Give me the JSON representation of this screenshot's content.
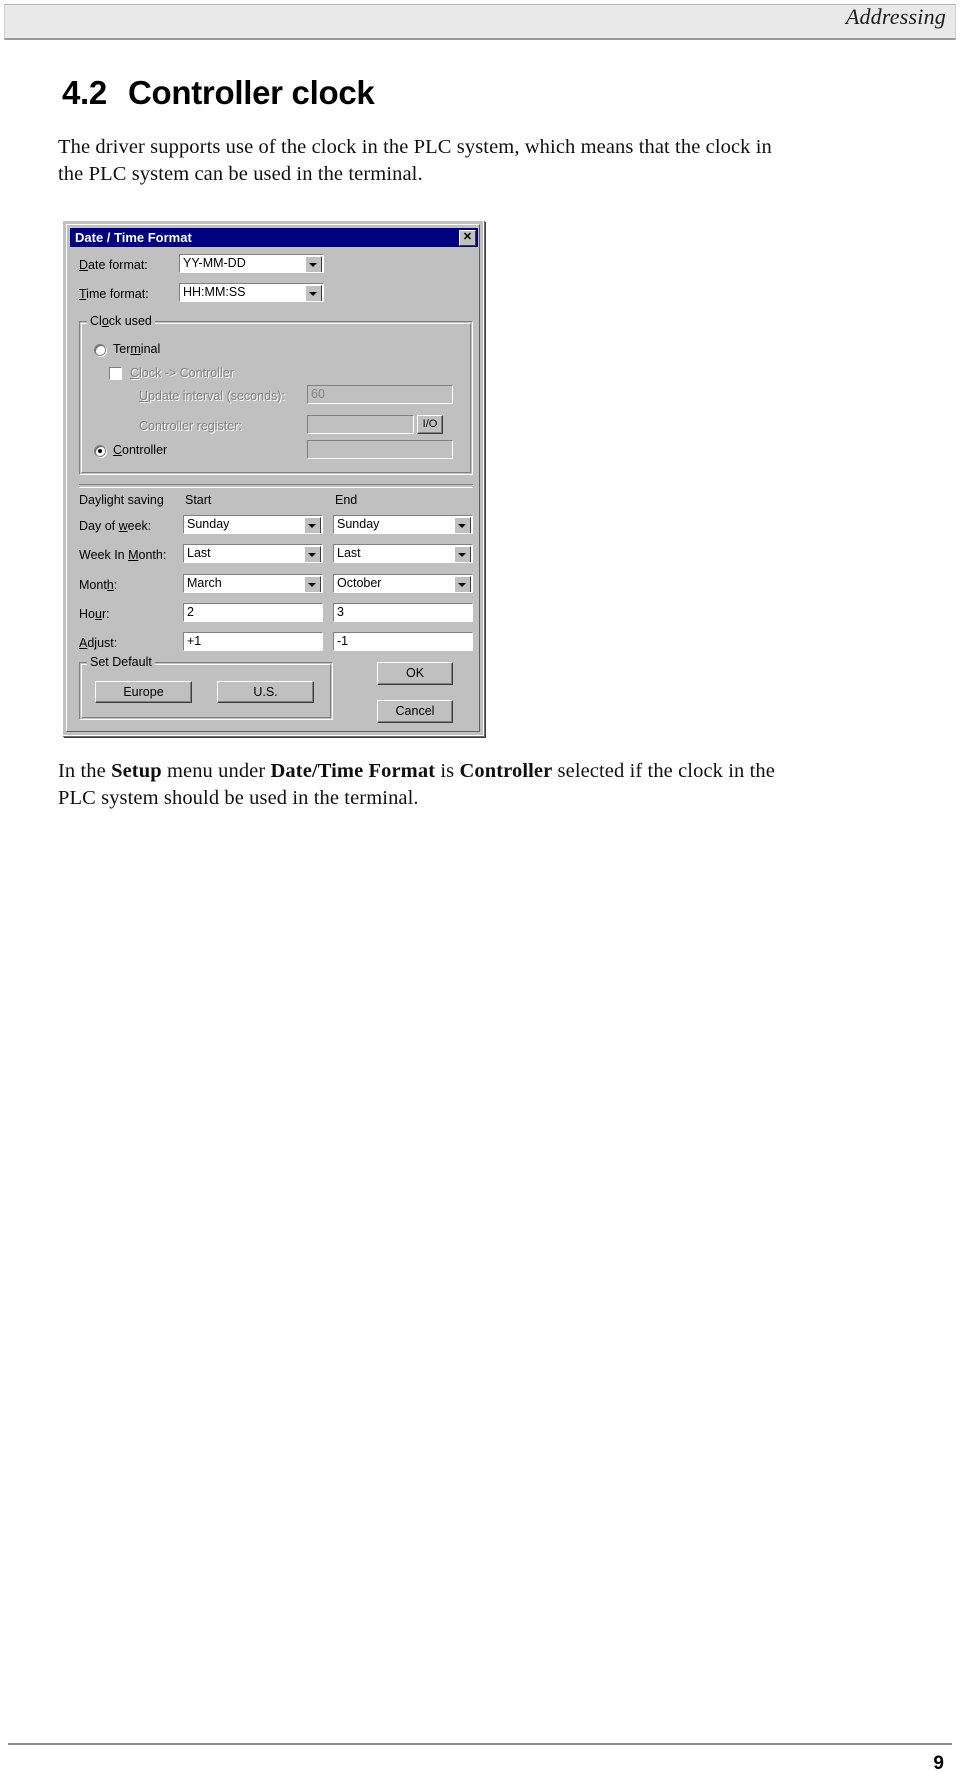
{
  "header": {
    "running_title": "Addressing"
  },
  "section": {
    "number": "4.2",
    "title": "Controller clock"
  },
  "intro_paragraph": "The driver supports use of the clock in the PLC system, which means that the clock in the PLC system can be used in the terminal.",
  "outro_paragraph_parts": {
    "p1": "In the ",
    "b1": "Setup",
    "p2": " menu under ",
    "b2": "Date/Time Format",
    "p3": " is ",
    "b3": "Controller",
    "p4": " selected if the clock in the PLC system should be used in the terminal."
  },
  "dialog": {
    "title": "Date / Time Format",
    "close_glyph": "✕",
    "date_format": {
      "label": "Date format:",
      "accel": "D",
      "value": "YY-MM-DD"
    },
    "time_format": {
      "label": "Time format:",
      "accel": "T",
      "value": "HH:MM:SS"
    },
    "clock_used": {
      "group_label": "Clock used",
      "terminal_radio": {
        "label": "Terminal",
        "accel": "m",
        "selected": false
      },
      "clock_to_controller_checkbox": {
        "label": "Clock -> Controller",
        "accel": "C",
        "checked": false,
        "enabled": false
      },
      "update_interval": {
        "label": "Update interval (seconds):",
        "accel": "U",
        "value": "60",
        "enabled": false
      },
      "controller_register": {
        "label": "Controller register:",
        "value": "",
        "enabled": false,
        "io_button_label": "I/O"
      },
      "controller_radio": {
        "label": "Controller",
        "accel": "C",
        "selected": true
      },
      "controller_register_value2": ""
    },
    "daylight_saving": {
      "section_label": "Daylight saving",
      "column_start": "Start",
      "column_end": "End",
      "rows": [
        {
          "label": "Day of week:",
          "accel": "w",
          "type": "combo",
          "start": "Sunday",
          "end": "Sunday"
        },
        {
          "label": "Week In Month:",
          "accel": "M",
          "type": "combo",
          "start": "Last",
          "end": "Last"
        },
        {
          "label": "Month:",
          "accel": "h",
          "type": "combo",
          "start": "March",
          "end": "October"
        },
        {
          "label": "Hour:",
          "accel": "u",
          "type": "edit",
          "start": "2",
          "end": "3"
        },
        {
          "label": "Adjust:",
          "accel": "A",
          "type": "edit",
          "start": "+1",
          "end": "-1"
        }
      ]
    },
    "set_default": {
      "group_label": "Set Default",
      "europe_button": "Europe",
      "us_button": "U.S."
    },
    "ok_button": "OK",
    "cancel_button": "Cancel"
  },
  "footer": {
    "page_number": "9"
  },
  "colors": {
    "titlebar": "#000080",
    "dialog_face": "#c0c0c0",
    "header_band": "#e9e9e9",
    "disabled_text": "#808080"
  }
}
